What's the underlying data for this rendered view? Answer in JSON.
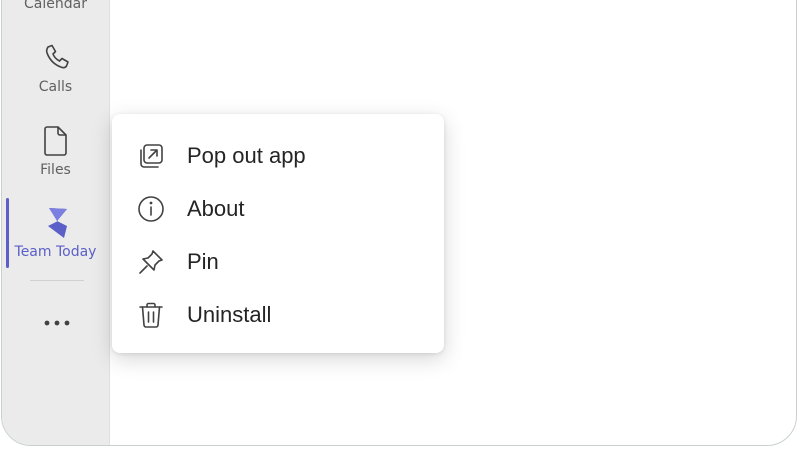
{
  "rail": {
    "items": [
      {
        "label": "Calendar",
        "icon": "calendar-icon"
      },
      {
        "label": "Calls",
        "icon": "phone-icon"
      },
      {
        "label": "Files",
        "icon": "file-icon"
      },
      {
        "label": "Team Today",
        "icon": "team-today-app-icon",
        "active": true
      }
    ],
    "more_icon": "ellipsis-icon"
  },
  "context_menu": {
    "items": [
      {
        "label": "Pop out app",
        "icon": "pop-out-icon"
      },
      {
        "label": "About",
        "icon": "info-icon"
      },
      {
        "label": "Pin",
        "icon": "pin-icon"
      },
      {
        "label": "Uninstall",
        "icon": "trash-icon"
      }
    ]
  },
  "colors": {
    "accent": "#5b5fc7",
    "rail_background": "#ebebeb",
    "text": "#242424",
    "rail_text": "#616161"
  }
}
